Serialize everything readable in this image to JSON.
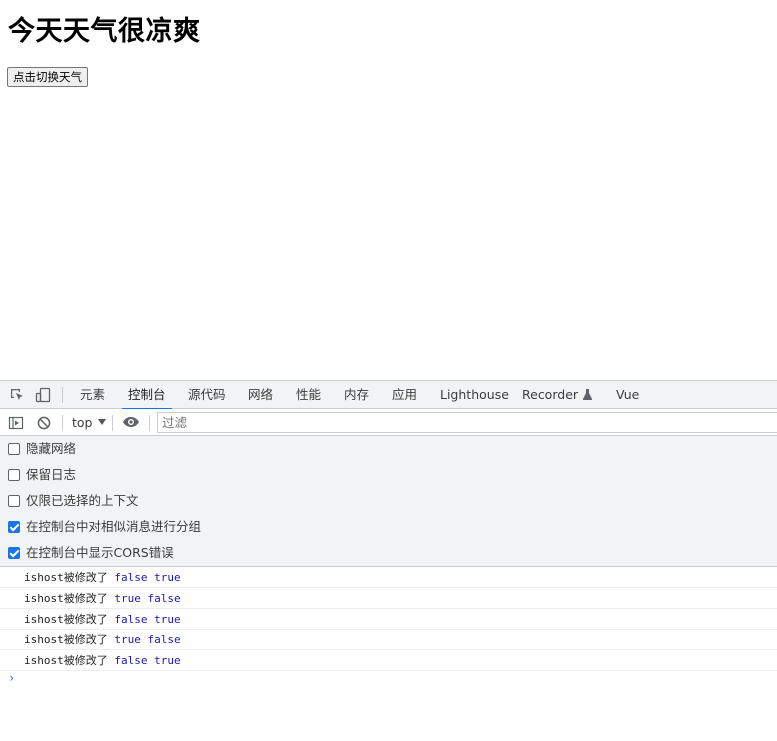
{
  "page": {
    "title": "今天天气很凉爽",
    "button_label": "点击切换天气"
  },
  "devtools": {
    "tabs": [
      {
        "label": "元素"
      },
      {
        "label": "控制台",
        "active": true
      },
      {
        "label": "源代码"
      },
      {
        "label": "网络"
      },
      {
        "label": "性能"
      },
      {
        "label": "内存"
      },
      {
        "label": "应用"
      },
      {
        "label": "Lighthouse"
      },
      {
        "label": "Recorder"
      },
      {
        "label": "Vue"
      }
    ],
    "toolbar": {
      "context_selector": "top",
      "filter_placeholder": "过滤"
    },
    "settings": [
      {
        "label": "隐藏网络",
        "checked": false
      },
      {
        "label": "保留日志",
        "checked": false
      },
      {
        "label": "仅限已选择的上下文",
        "checked": false
      },
      {
        "label": "在控制台中对相似消息进行分组",
        "checked": true
      },
      {
        "label": "在控制台中显示CORS错误",
        "checked": true
      }
    ],
    "messages": [
      {
        "text": "ishost被修改了",
        "values": "false true"
      },
      {
        "text": "ishost被修改了",
        "values": "true false"
      },
      {
        "text": "ishost被修改了",
        "values": "false true"
      },
      {
        "text": "ishost被修改了",
        "values": "true false"
      },
      {
        "text": "ishost被修改了",
        "values": "false true"
      }
    ],
    "prompt_symbol": "›",
    "accent_color": "#1a73e8",
    "value_color": "#1a1aa6"
  }
}
